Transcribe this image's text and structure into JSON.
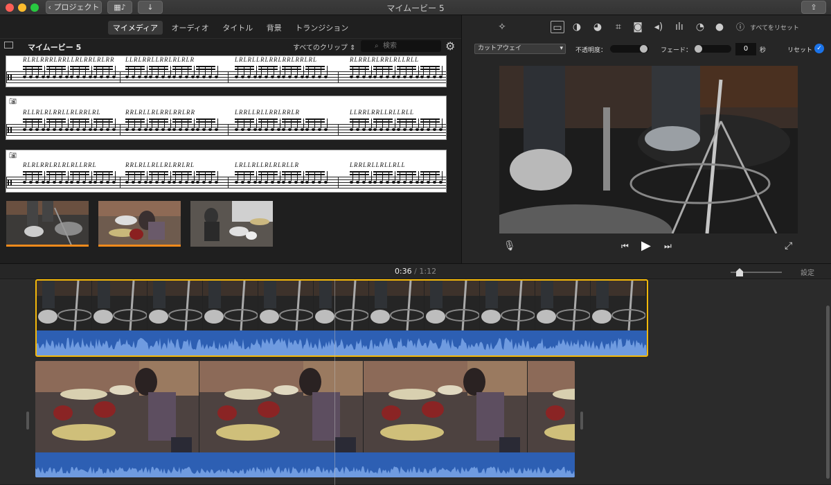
{
  "window": {
    "title": "マイムービー 5",
    "back_label": "プロジェクト"
  },
  "media_tabs": [
    "マイメディア",
    "オーディオ",
    "タイトル",
    "背景",
    "トランジション"
  ],
  "library": {
    "event_title": "マイムービー 5",
    "filter_label": "すべてのクリップ",
    "search_placeholder": "検索"
  },
  "sheets": [
    {
      "sticks": [
        "RLRLRRRLRRLLRLRRLRLRR",
        "LLRLRRLLRRLRLRLR",
        "LRLRLLRLRRLRRLRRLRL",
        "RLRRLRLRRLRLLRLL"
      ],
      "camera": false
    },
    {
      "sticks": [
        "RLLRLRLRRLLRLRRLRL",
        "RRLRLLRLRRLRRLRR",
        "LRRLLRLLRRLRRLR",
        "LLRRLRRLLRLLRLL"
      ],
      "camera": true
    },
    {
      "sticks": [
        "RLRLRRLRLRLRLLRRL",
        "RRLRLLRLLRLRRLRL",
        "LRLLRLLRLRLRLLR",
        "LRRLRLLRLLRLL"
      ],
      "camera": true
    }
  ],
  "viewer": {
    "effect_select": "カットアウェイ",
    "opacity_label": "不透明度：",
    "fade_label": "フェード：",
    "fade_value": "0",
    "seconds_unit": "秒",
    "reset_label": "リセット",
    "reset_all_label": "すべてをリセット"
  },
  "timeline": {
    "current_time": "0:36",
    "separator": "/",
    "total_time": "1:12",
    "settings_label": "設定"
  },
  "colors": {
    "accent": "#1b73e8",
    "audio_wave": "#2d5fb3",
    "selection": "#f5b90a"
  }
}
